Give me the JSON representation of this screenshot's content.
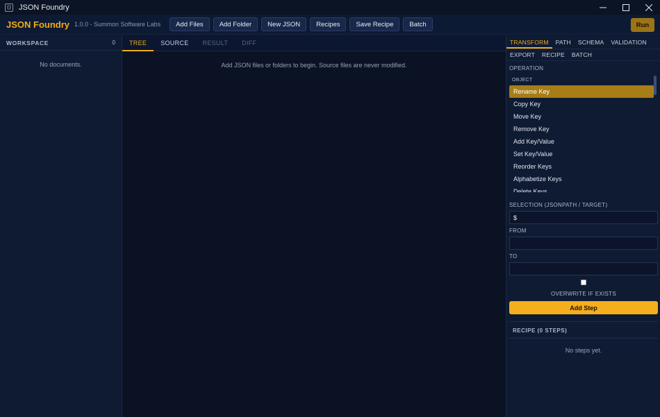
{
  "window": {
    "title": "JSON Foundry",
    "icon": "bracket-icon"
  },
  "toolbar": {
    "brand": "JSON Foundry",
    "version": "1.0.0 - Summon Software Labs",
    "buttons": [
      "Add Files",
      "Add Folder",
      "New JSON",
      "Recipes",
      "Save Recipe",
      "Batch"
    ],
    "run": "Run"
  },
  "sidebar": {
    "title": "WORKSPACE",
    "count": "0",
    "empty": "No documents."
  },
  "center": {
    "tabs": [
      "TREE",
      "SOURCE",
      "RESULT",
      "DIFF"
    ],
    "active_tab": "TREE",
    "message": "Add JSON files or folders to begin. Source files are never modified."
  },
  "panel": {
    "tabs_row1": [
      "TRANSFORM",
      "PATH",
      "SCHEMA",
      "VALIDATION"
    ],
    "tabs_row2": [
      "EXPORT",
      "RECIPE",
      "BATCH"
    ],
    "active_tab": "TRANSFORM",
    "operation_label": "OPERATION",
    "group_label": "OBJECT",
    "operations": [
      "Rename Key",
      "Copy Key",
      "Move Key",
      "Remove Key",
      "Add Key/Value",
      "Set Key/Value",
      "Reorder Keys",
      "Alphabetize Keys",
      "Delete Keys"
    ],
    "selected_operation": "Rename Key",
    "selection_label": "SELECTION (JSONPATH / TARGET)",
    "selection_value": "$",
    "from_label": "FROM",
    "from_value": "",
    "to_label": "TO",
    "to_value": "",
    "overwrite_label": "OVERWRITE IF EXISTS",
    "overwrite_checked": false,
    "add_step": "Add Step",
    "recipe_title": "RECIPE (0 STEPS)",
    "recipe_empty": "No steps yet."
  },
  "colors": {
    "accent": "#f0ad1a",
    "selected": "#a77d17",
    "background": "#0a1224",
    "panel": "#0f1b33"
  }
}
